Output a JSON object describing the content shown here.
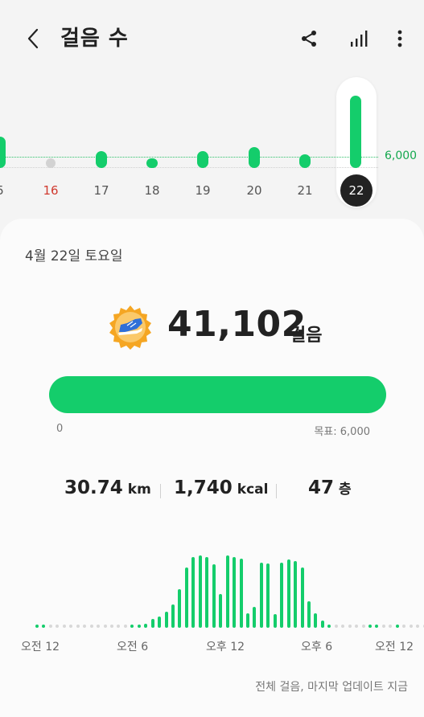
{
  "header": {
    "title": "걸음 수",
    "back_icon": "chevron-left-icon",
    "share_icon": "share-icon",
    "chart_icon": "bar-chart-icon",
    "more_icon": "more-vertical-icon"
  },
  "colors": {
    "accent": "#14cd6b",
    "today_circle": "#222222",
    "sunday_red": "#d03a2f"
  },
  "week": {
    "goal_label": "6,000",
    "selected_day": "22",
    "days": [
      {
        "label": "5",
        "value": 7500,
        "red": false
      },
      {
        "label": "16",
        "value": 0,
        "red": true
      },
      {
        "label": "17",
        "value": 2500,
        "red": false
      },
      {
        "label": "18",
        "value": 400,
        "red": false
      },
      {
        "label": "19",
        "value": 2500,
        "red": false
      },
      {
        "label": "20",
        "value": 3500,
        "red": false
      },
      {
        "label": "21",
        "value": 1800,
        "red": false
      },
      {
        "label": "22",
        "value": 41102,
        "red": false
      }
    ]
  },
  "summary": {
    "date": "4월 22일 토요일",
    "steps": "41,102",
    "steps_unit": "걸음",
    "badge_icon": "running-shoe-badge-icon",
    "progress_fraction": 1.0,
    "progress_min": "0",
    "progress_goal": "목표: 6,000"
  },
  "stats": {
    "distance_value": "30.74",
    "distance_unit": "km",
    "calories_value": "1,740",
    "calories_unit": "kcal",
    "floors_value": "47",
    "floors_unit": "층"
  },
  "hourly": {
    "levels": [
      2,
      2,
      0,
      0,
      0,
      0,
      0,
      0,
      0,
      0,
      0,
      0,
      0,
      0,
      2,
      2,
      5,
      12,
      15,
      22,
      32,
      52,
      82,
      96,
      98,
      96,
      86,
      46,
      98,
      96,
      93,
      20,
      28,
      88,
      87,
      18,
      88,
      92,
      90,
      82,
      36,
      20,
      10,
      4,
      0,
      0,
      0,
      0,
      0,
      2,
      2,
      0,
      0,
      2,
      0,
      0,
      0,
      0
    ],
    "labels": [
      "오전 12",
      "오전 6",
      "오후 12",
      "오후 6",
      "오전 12"
    ]
  },
  "footnote": "전체 걸음, 마지막 업데이트 지금"
}
